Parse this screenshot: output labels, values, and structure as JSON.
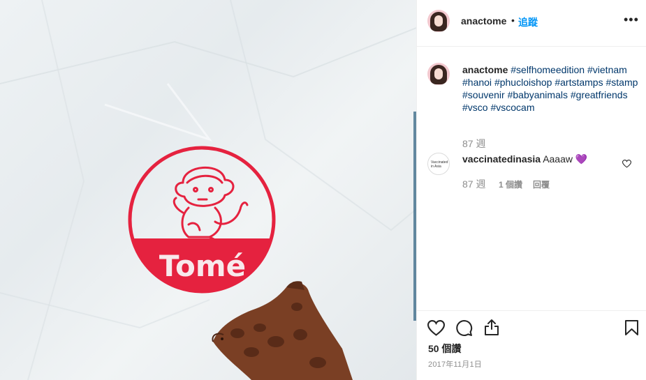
{
  "post": {
    "username": "anactome",
    "dot": "•",
    "follow_label": "追蹤",
    "more_icon": "more-options-icon",
    "more_glyph": "•••"
  },
  "photo": {
    "stamp_text": "Tomé",
    "stamp_color": "#e5223f"
  },
  "caption": {
    "username": "anactome",
    "hashtags": [
      "#selfhomeedition",
      "#vietnam",
      "#hanoi",
      "#phucloishop",
      "#artstamps",
      "#stamp",
      "#souvenir",
      "#babyanimals",
      "#greatfriends",
      "#vsco",
      "#vscocam"
    ],
    "age": "87 週"
  },
  "comments": [
    {
      "username": "vaccinatedinasia",
      "text": "Aaaaw 💜",
      "avatar_text": "Vaccinated in Asia",
      "age": "87 週",
      "likes": "1 個讚",
      "reply": "回覆"
    }
  ],
  "actions": {
    "likes": "50 個讚",
    "date": "2017年11月1日"
  },
  "colors": {
    "link": "#00376b",
    "follow": "#0095f6",
    "muted": "#8e8e8e",
    "text": "#262626"
  }
}
